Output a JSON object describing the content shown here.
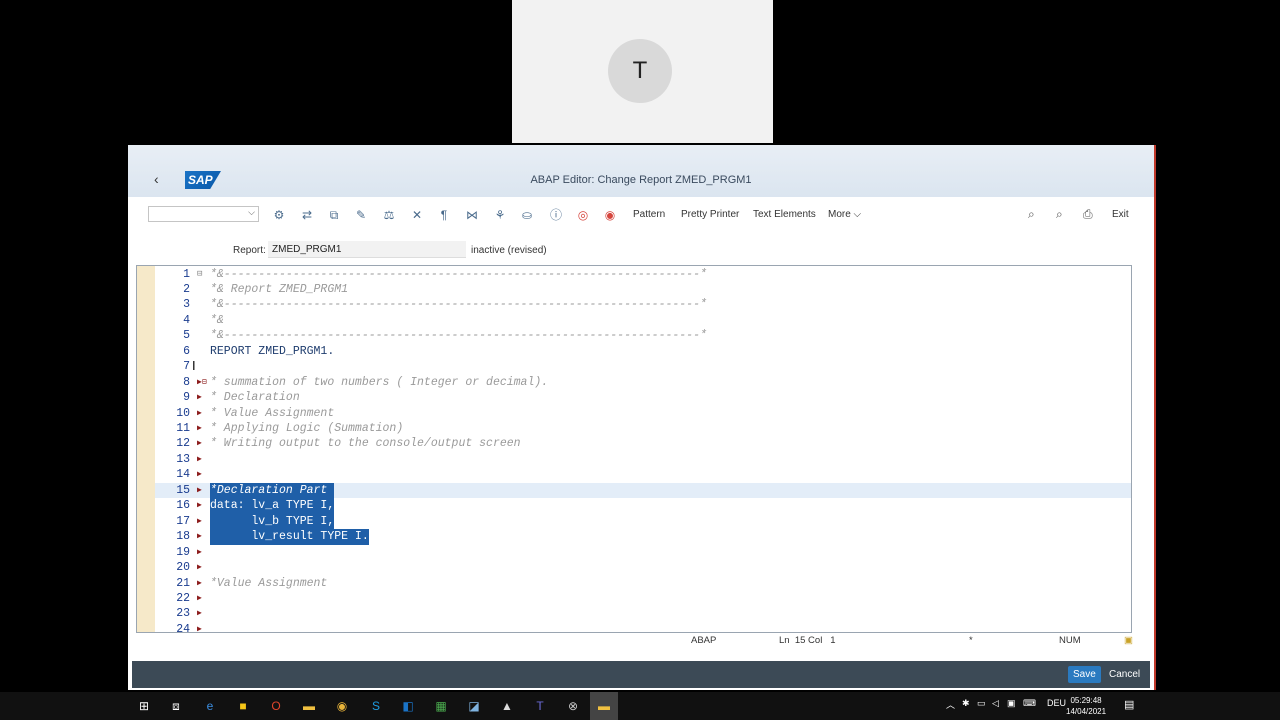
{
  "avatar": {
    "initial": "T"
  },
  "window": {
    "title": "ABAP Editor: Change Report ZMED_PRGM1",
    "logo": "SAP",
    "back": "‹"
  },
  "toolbar": {
    "select_value": "",
    "buttons": {
      "pattern": "Pattern",
      "pretty_printer": "Pretty Printer",
      "text_elements": "Text Elements",
      "more": "More ⌵",
      "exit": "Exit"
    }
  },
  "report": {
    "label": "Report:",
    "name": "ZMED_PRGM1",
    "status": "inactive (revised)"
  },
  "editor": {
    "lines": [
      {
        "n": "1",
        "text": "*&---------------------------------------------------------------------*",
        "kind": "comment",
        "fold": "box"
      },
      {
        "n": "2",
        "text": "*& Report ZMED_PRGM1",
        "kind": "comment",
        "fold": ""
      },
      {
        "n": "3",
        "text": "*&---------------------------------------------------------------------*",
        "kind": "comment",
        "fold": ""
      },
      {
        "n": "4",
        "text": "*&",
        "kind": "comment",
        "fold": ""
      },
      {
        "n": "5",
        "text": "*&---------------------------------------------------------------------*",
        "kind": "comment",
        "fold": ""
      },
      {
        "n": "6",
        "text": "REPORT ZMED_PRGM1.",
        "kind": "code",
        "fold": ""
      },
      {
        "n": "7",
        "text": "",
        "kind": "code",
        "fold": ""
      },
      {
        "n": "8",
        "text": "* summation of two numbers ( Integer or decimal).",
        "kind": "comment",
        "fold": "arrow-box"
      },
      {
        "n": "9",
        "text": "* Declaration",
        "kind": "comment",
        "fold": "arrow"
      },
      {
        "n": "10",
        "text": "* Value Assignment",
        "kind": "comment",
        "fold": "arrow"
      },
      {
        "n": "11",
        "text": "* Applying Logic (Summation)",
        "kind": "comment",
        "fold": "arrow"
      },
      {
        "n": "12",
        "text": "* Writing output to the console/output screen",
        "kind": "comment",
        "fold": "arrow"
      },
      {
        "n": "13",
        "text": "",
        "kind": "code",
        "fold": "arrow"
      },
      {
        "n": "14",
        "text": "",
        "kind": "code",
        "fold": "arrow"
      },
      {
        "n": "15",
        "text": "*Declaration Part ",
        "kind": "comment",
        "fold": "arrow",
        "selected": true
      },
      {
        "n": "16",
        "text": "data: lv_a TYPE I,",
        "kind": "code",
        "fold": "arrow",
        "selected": true
      },
      {
        "n": "17",
        "text": "      lv_b TYPE I,",
        "kind": "code",
        "fold": "arrow",
        "selected": true
      },
      {
        "n": "18",
        "text": "      lv_result TYPE I.",
        "kind": "code",
        "fold": "arrow",
        "selected": true
      },
      {
        "n": "19",
        "text": "",
        "kind": "code",
        "fold": "arrow"
      },
      {
        "n": "20",
        "text": "",
        "kind": "code",
        "fold": "arrow"
      },
      {
        "n": "21",
        "text": "*Value Assignment",
        "kind": "comment",
        "fold": "arrow"
      },
      {
        "n": "22",
        "text": "",
        "kind": "code",
        "fold": "arrow"
      },
      {
        "n": "23",
        "text": "",
        "kind": "code",
        "fold": "arrow"
      },
      {
        "n": "24",
        "text": "",
        "kind": "code",
        "fold": "arrow"
      }
    ]
  },
  "status_bar": {
    "language": "ABAP",
    "position": "Ln  15 Col   1",
    "mode": "*",
    "num": "NUM"
  },
  "footer": {
    "save": "Save",
    "cancel": "Cancel"
  },
  "taskbar": {
    "lang": "DEU",
    "time": "05:29:48",
    "date": "14/04/2021"
  }
}
